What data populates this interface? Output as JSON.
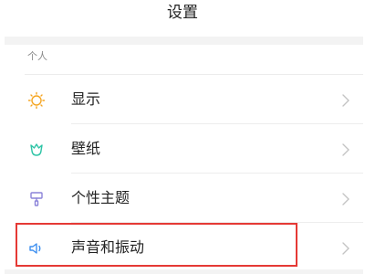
{
  "header": {
    "title": "设置"
  },
  "section": {
    "label": "个人"
  },
  "items": [
    {
      "label": "显示",
      "icon": "sun-icon",
      "icon_color": "#f5a623"
    },
    {
      "label": "壁纸",
      "icon": "tulip-icon",
      "icon_color": "#2ec4a6"
    },
    {
      "label": "个性主题",
      "icon": "paint-roller-icon",
      "icon_color": "#8b83d9"
    },
    {
      "label": "声音和振动",
      "icon": "speaker-icon",
      "icon_color": "#3d8ff0"
    }
  ],
  "highlight": {
    "target": "声音和振动",
    "color": "#e53935"
  }
}
